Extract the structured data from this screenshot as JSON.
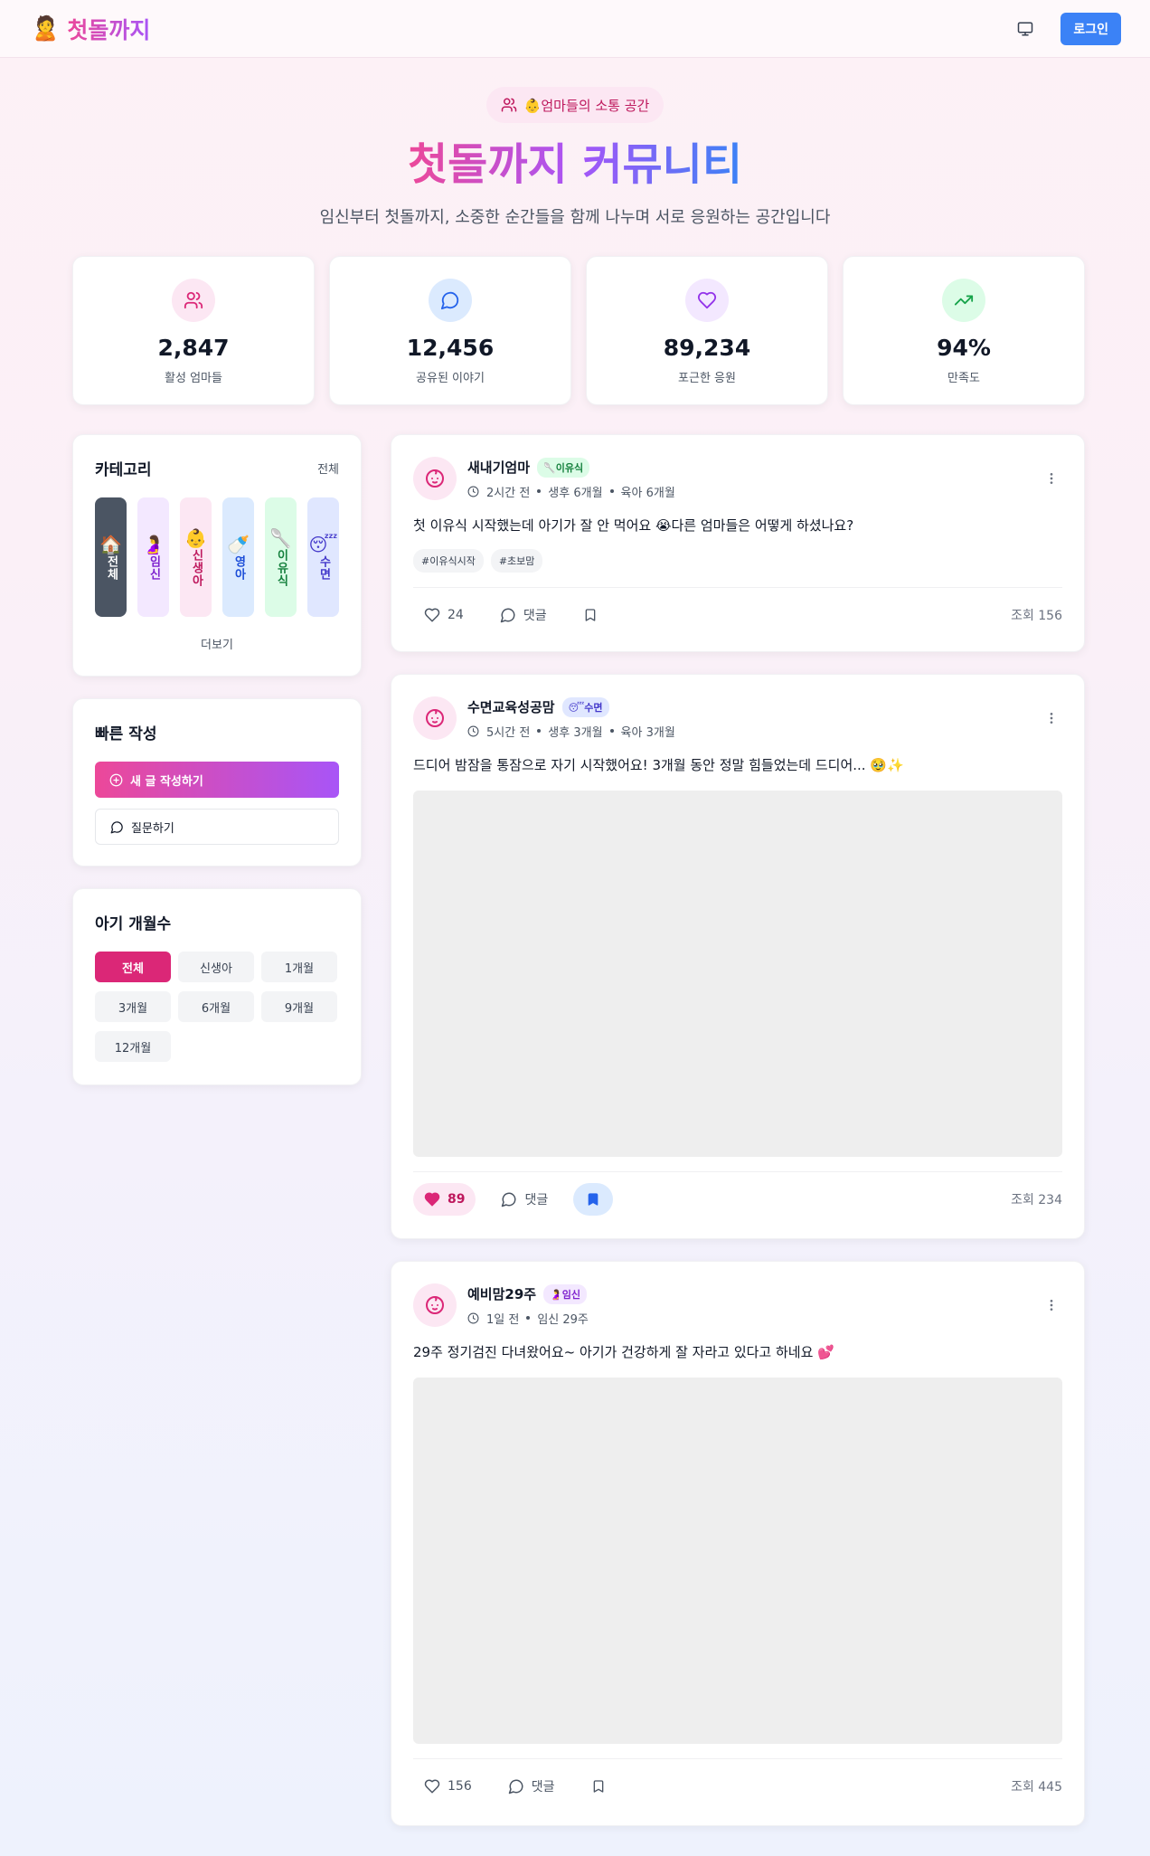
{
  "header": {
    "logo_emoji": "🙎",
    "logo_text": "첫돌까지",
    "login_label": "로그인"
  },
  "hero": {
    "badge_emoji": "👶",
    "badge_text": "엄마들의 소통 공간",
    "title": "첫돌까지 커뮤니티",
    "subtitle": "임신부터 첫돌까지, 소중한 순간들을 함께 나누며 서로 응원하는 공간입니다"
  },
  "stats": [
    {
      "value": "2,847",
      "label": "활성 엄마들",
      "icon": "users-icon",
      "color": "#db2777",
      "bg": "#fce7f3"
    },
    {
      "value": "12,456",
      "label": "공유된 이야기",
      "icon": "message-icon",
      "color": "#2563eb",
      "bg": "#dbeafe"
    },
    {
      "value": "89,234",
      "label": "포근한 응원",
      "icon": "heart-icon",
      "color": "#9333ea",
      "bg": "#f3e8ff"
    },
    {
      "value": "94%",
      "label": "만족도",
      "icon": "trending-up-icon",
      "color": "#16a34a",
      "bg": "#dcfce7"
    }
  ],
  "categories": {
    "title": "카테고리",
    "all_link": "전체",
    "more": "더보기",
    "items": [
      {
        "emoji": "🏠",
        "label": "전체",
        "bg": "#4b5563",
        "fg": "#ffffff"
      },
      {
        "emoji": "🤰",
        "label": "임신",
        "bg": "#f3e8ff",
        "fg": "#7e22ce"
      },
      {
        "emoji": "👶",
        "label": "신생아",
        "bg": "#fce7f3",
        "fg": "#be185d"
      },
      {
        "emoji": "🍼",
        "label": "영아",
        "bg": "#dbeafe",
        "fg": "#1d4ed8"
      },
      {
        "emoji": "🥄",
        "label": "이유식",
        "bg": "#dcfce7",
        "fg": "#15803d"
      },
      {
        "emoji": "😴",
        "label": "수면",
        "bg": "#e0e7ff",
        "fg": "#4338ca"
      }
    ]
  },
  "quick": {
    "title": "빠른 작성",
    "write_label": "새 글 작성하기",
    "ask_label": "질문하기"
  },
  "ages": {
    "title": "아기 개월수",
    "items": [
      "전체",
      "신생아",
      "1개월",
      "3개월",
      "6개월",
      "9개월",
      "12개월"
    ],
    "active_index": 0
  },
  "posts": [
    {
      "author": "새내기엄마",
      "tag": "🥄이유식",
      "tag_bg": "#dcfce7",
      "tag_fg": "#15803d",
      "time": "2시간 전",
      "meta1": "생후 6개월",
      "meta2": "육아 6개월",
      "text": "첫 이유식 시작했는데 아기가 잘 안 먹어요 😭다른 엄마들은 어떻게 하셨나요?",
      "hashtags": [
        "#이유식시작",
        "#초보맘"
      ],
      "likes": "24",
      "comment_label": "댓글",
      "views": "조회 156",
      "liked": false,
      "saved": false,
      "has_image": false
    },
    {
      "author": "수면교육성공맘",
      "tag": "😴수면",
      "tag_bg": "#e0e7ff",
      "tag_fg": "#4338ca",
      "time": "5시간 전",
      "meta1": "생후 3개월",
      "meta2": "육아 3개월",
      "text": "드디어 밤잠을 통잠으로 자기 시작했어요! 3개월 동안 정말 힘들었는데 드디어... 🥹✨",
      "hashtags": [],
      "likes": "89",
      "comment_label": "댓글",
      "views": "조회 234",
      "liked": true,
      "saved": true,
      "has_image": true
    },
    {
      "author": "예비맘29주",
      "tag": "🤰임신",
      "tag_bg": "#f3e8ff",
      "tag_fg": "#7e22ce",
      "time": "1일 전",
      "meta1": "임신 29주",
      "meta2": "",
      "text": "29주 정기검진 다녀왔어요~ 아기가 건강하게 잘 자라고 있다고 하네요 💕",
      "hashtags": [],
      "likes": "156",
      "comment_label": "댓글",
      "views": "조회 445",
      "liked": false,
      "saved": false,
      "has_image": true
    }
  ]
}
